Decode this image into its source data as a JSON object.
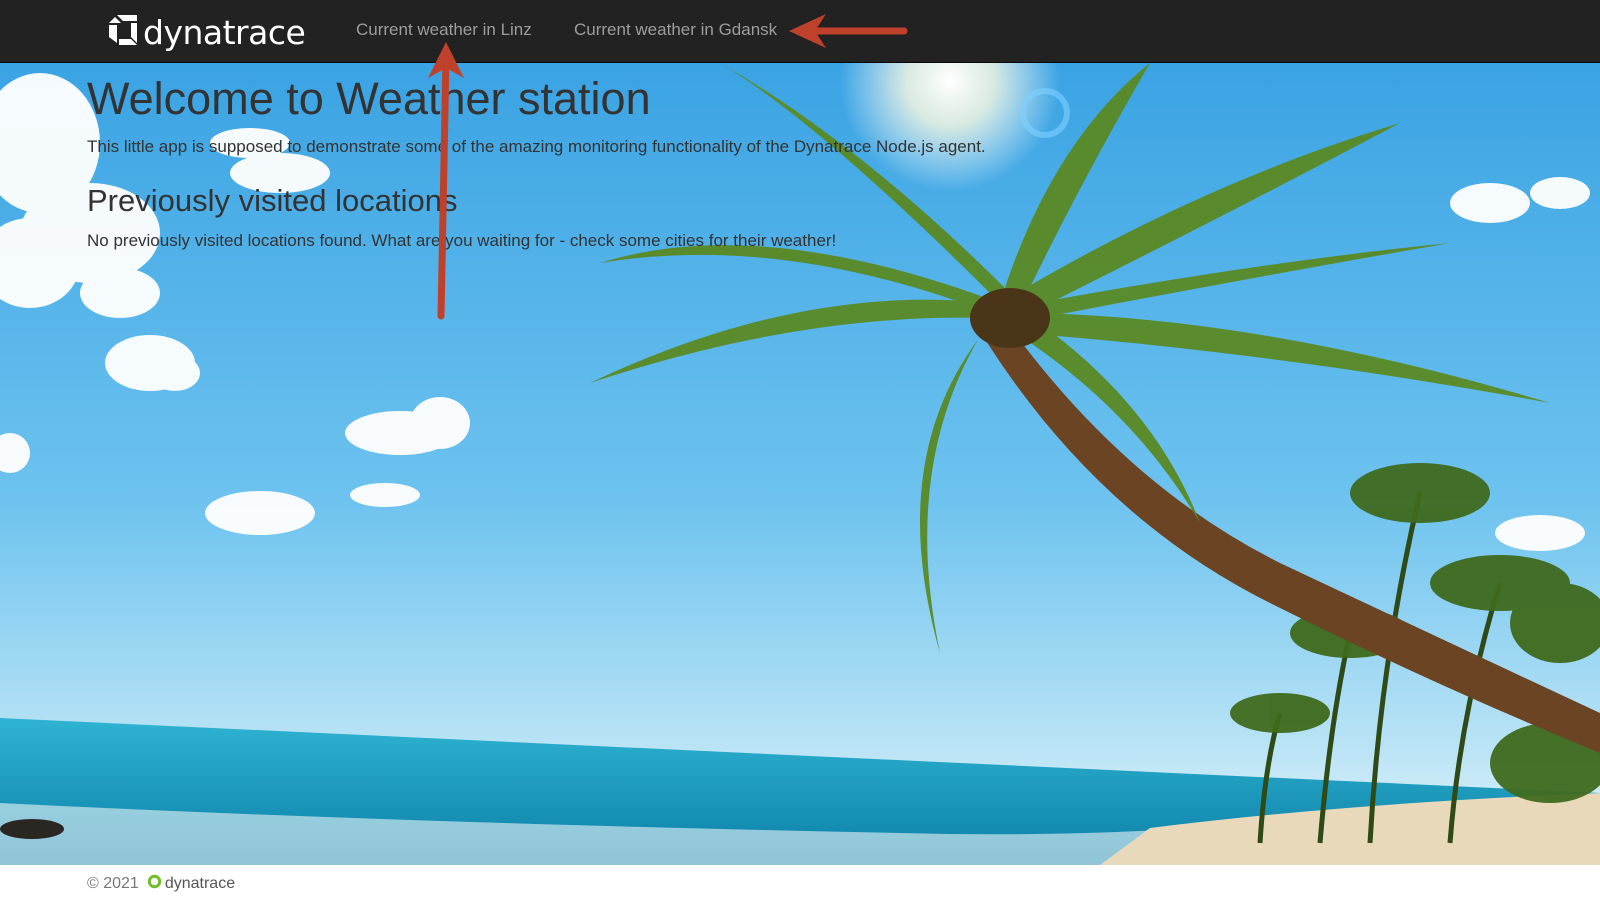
{
  "brand": {
    "name": "dynatrace"
  },
  "nav": {
    "links": [
      {
        "label": "Current weather in Linz"
      },
      {
        "label": "Current weather in Gdansk"
      }
    ]
  },
  "main": {
    "title": "Welcome to Weather station",
    "intro": "This little app is supposed to demonstrate some of the amazing monitoring functionality of the Dynatrace Node.js agent.",
    "history_title": "Previously visited locations",
    "history_empty": "No previously visited locations found. What are you waiting for - check some cities for their weather!"
  },
  "footer": {
    "copyright": "© 2021",
    "logo_text": "dynatrace"
  },
  "colors": {
    "navbar_bg": "#222222",
    "nav_link": "#9d9d9d",
    "text": "#333333",
    "annotation_arrow": "#c0412b",
    "sky": "#5cb8ec",
    "sea": "#1aa6c8"
  },
  "icons": {
    "brand_logo": "dynatrace-logo-icon",
    "footer_logo": "dynatrace-ring-icon"
  }
}
